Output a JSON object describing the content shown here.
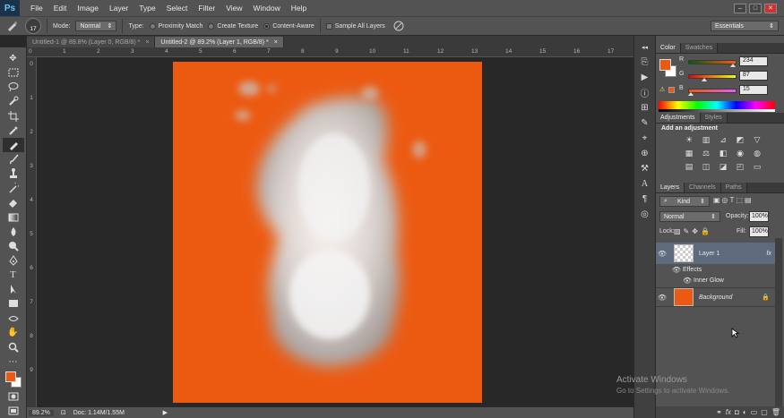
{
  "app": {
    "logo": "Ps"
  },
  "menu": [
    "File",
    "Edit",
    "Image",
    "Layer",
    "Type",
    "Select",
    "Filter",
    "View",
    "Window",
    "Help"
  ],
  "window_controls": {
    "minimize": "–",
    "maximize": "□",
    "close": "✕"
  },
  "options": {
    "brush_size": "17",
    "mode_label": "Mode:",
    "mode_value": "Normal",
    "type_label": "Type:",
    "type_options": [
      "Proximity Match",
      "Create Texture",
      "Content-Aware"
    ],
    "type_selected": "Content-Aware",
    "sample_all_layers": "Sample All Layers",
    "workspace": "Essentials"
  },
  "tabs": [
    {
      "label": "Untitled-1 @ 89.8% (Layer 0, RGB/8) *",
      "active": false
    },
    {
      "label": "Untitled-2 @ 89.2% (Layer 1, RGB/8) *",
      "active": true
    }
  ],
  "ruler_top": [
    "0",
    "1",
    "2",
    "3",
    "4",
    "5",
    "6",
    "7",
    "8",
    "9",
    "10",
    "11",
    "12",
    "13",
    "14",
    "15",
    "16",
    "17"
  ],
  "ruler_left": [
    "0",
    "1",
    "2",
    "3",
    "4",
    "5",
    "6",
    "7",
    "8",
    "9"
  ],
  "status": {
    "zoom": "89.2%",
    "doc": "Doc: 1.14M/1.55M"
  },
  "colors": {
    "foreground": "#ea5a12",
    "background": "#ffffff",
    "canvas_fill": "#ec5a12"
  },
  "color_panel": {
    "tabs": [
      "Color",
      "Swatches"
    ],
    "channels": [
      {
        "name": "R",
        "value": "234",
        "gradient": "linear-gradient(90deg,#005a0f,#ff5a0f)",
        "level": 0.92
      },
      {
        "name": "G",
        "value": "87",
        "gradient": "linear-gradient(90deg,#ea000f,#eaff0f)",
        "level": 0.34
      },
      {
        "name": "B",
        "value": "15",
        "gradient": "linear-gradient(90deg,#ea5a00,#ea5aff)",
        "level": 0.06
      }
    ]
  },
  "adjustments_panel": {
    "tabs": [
      "Adjustments",
      "Styles"
    ],
    "heading": "Add an adjustment"
  },
  "layers_panel": {
    "tabs": [
      "Layers",
      "Channels",
      "Paths"
    ],
    "kind": "Kind",
    "blend_mode": "Normal",
    "opacity_label": "Opacity:",
    "opacity": "100%",
    "lock_label": "Lock:",
    "fill_label": "Fill:",
    "fill": "100%",
    "layers": [
      {
        "name": "Layer 1",
        "fx": "fx",
        "effects_label": "Effects",
        "effect": "Inner Glow",
        "selected": true
      },
      {
        "name": "Background",
        "selected": false
      }
    ]
  },
  "activation": {
    "title": "Activate Windows",
    "subtitle": "Go to Settings to activate Windows."
  }
}
